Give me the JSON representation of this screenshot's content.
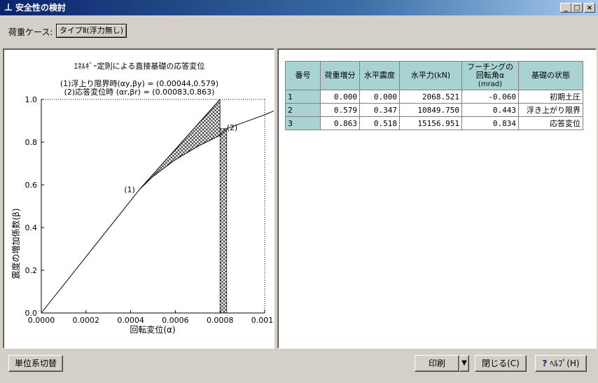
{
  "window": {
    "title": "安全性の検討",
    "icon": "app-icon",
    "controls": [
      "_",
      "□",
      "×"
    ]
  },
  "load_case": {
    "label": "荷重ケース:",
    "value": "タイプⅡ(浮力無し)"
  },
  "chart_data": {
    "type": "line",
    "title": "ｴﾈﾙｷﾞｰ定則による直接基礎の応答変位",
    "annotations": [
      "(1)浮上り限界時(αy,βy) = (0.00044,0.579)",
      "(2)応答変位時 (αr,βr) = (0.00083,0.863)"
    ],
    "point_labels": [
      "(1)",
      "(2)"
    ],
    "xlabel": "回転変位(α)",
    "ylabel": "震度の増加係数(β)",
    "xlim": [
      0,
      0.001
    ],
    "ylim": [
      0,
      1.0
    ],
    "xticks": [
      "0.0000",
      "0.0002",
      "0.0004",
      "0.0006",
      "0.0008",
      "0.0010"
    ],
    "yticks": [
      "0.0",
      "0.2",
      "0.4",
      "0.6",
      "0.8",
      "1.0"
    ],
    "series": [
      {
        "x": [
          0,
          0.00044,
          0.0005,
          0.0006,
          0.0007,
          0.0008,
          0.00083,
          0.0009,
          0.001,
          0.00105
        ],
        "y": [
          0,
          0.579,
          0.64,
          0.718,
          0.78,
          0.832,
          0.863,
          0.89,
          0.928,
          0.95
        ]
      }
    ],
    "reference_line": {
      "x": [
        0.00044,
        0.0008
      ],
      "y": [
        0.579,
        1.0
      ]
    },
    "hatched_region_x": [
      0.0008,
      0.00083
    ],
    "grid": false
  },
  "table": {
    "headers": [
      "番号",
      "荷重増分",
      "水平震度",
      "水平力(kN)",
      "フーチングの回転角α",
      "(mrad)",
      "基礎の状態"
    ],
    "rows": [
      [
        "1",
        "0.000",
        "0.000",
        "2068.521",
        "-0.060",
        "初期土圧"
      ],
      [
        "2",
        "0.579",
        "0.347",
        "10849.750",
        "0.443",
        "浮き上がり限界"
      ],
      [
        "3",
        "0.863",
        "0.518",
        "15156.951",
        "0.834",
        "応答変位"
      ]
    ]
  },
  "buttons": {
    "unit_switch": "単位系切替",
    "print": "印刷",
    "print_arrow": "▼",
    "close": "閉じる(C)",
    "help": "ﾍﾙﾌﾟ(H)",
    "help_icon": "?"
  }
}
